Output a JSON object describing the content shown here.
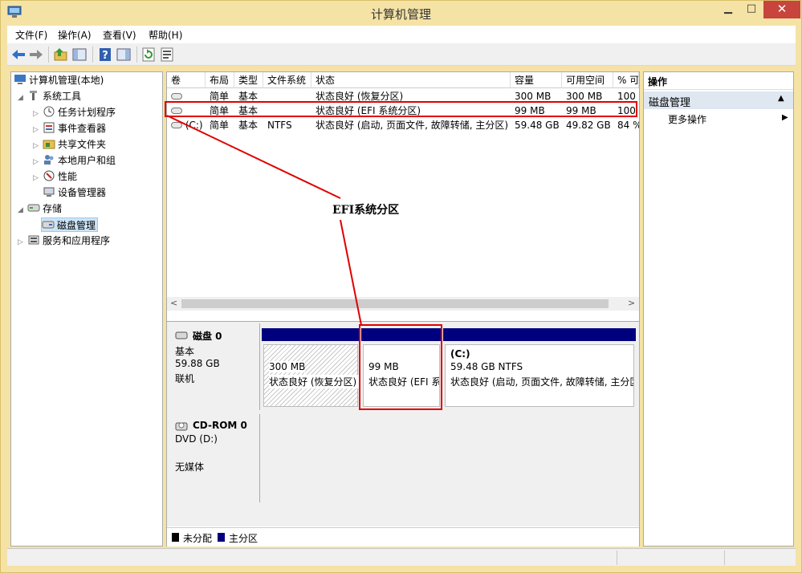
{
  "window": {
    "title": "计算机管理",
    "min_glyph": "▁",
    "max_glyph": "□",
    "close_glyph": "✕"
  },
  "menu": [
    {
      "label": "文件(F)"
    },
    {
      "label": "操作(A)"
    },
    {
      "label": "查看(V)"
    },
    {
      "label": "帮助(H)"
    }
  ],
  "toolbar_icons": [
    "back-arrow-icon",
    "forward-arrow-icon",
    "folder-up-icon",
    "show-hide-tree-icon",
    "help-icon",
    "show-hide-action-icon",
    "refresh-icon",
    "properties-icon"
  ],
  "tree": {
    "root": "计算机管理(本地)",
    "system_tools": "系统工具",
    "task_scheduler": "任务计划程序",
    "event_viewer": "事件查看器",
    "shared_folders": "共享文件夹",
    "local_users": "本地用户和组",
    "performance": "性能",
    "device_manager": "设备管理器",
    "storage": "存储",
    "disk_management": "磁盘管理",
    "services_apps": "服务和应用程序"
  },
  "volumes": {
    "headers": {
      "volume": "卷",
      "layout": "布局",
      "type": "类型",
      "fs": "文件系统",
      "status": "状态",
      "capacity": "容量",
      "free": "可用空间",
      "pct": "% 可"
    },
    "rows": [
      {
        "volume": "",
        "layout": "简单",
        "type": "基本",
        "fs": "",
        "status": "状态良好 (恢复分区)",
        "capacity": "300 MB",
        "free": "300 MB",
        "pct": "100"
      },
      {
        "volume": "",
        "layout": "简单",
        "type": "基本",
        "fs": "",
        "status": "状态良好 (EFI 系统分区)",
        "capacity": "99 MB",
        "free": "99 MB",
        "pct": "100"
      },
      {
        "volume": "(C:)",
        "layout": "简单",
        "type": "基本",
        "fs": "NTFS",
        "status": "状态良好 (启动, 页面文件, 故障转储, 主分区)",
        "capacity": "59.48 GB",
        "free": "49.82 GB",
        "pct": "84 %"
      }
    ]
  },
  "disk0": {
    "name": "磁盘 0",
    "type": "基本",
    "size": "59.88 GB",
    "state": "联机",
    "partitions": [
      {
        "name": "",
        "size": "300 MB",
        "status": "状态良好 (恢复分区)"
      },
      {
        "name": "",
        "size": "99 MB",
        "status": "状态良好 (EFI 系"
      },
      {
        "name": "(C:)",
        "size": "59.48 GB NTFS",
        "status": "状态良好 (启动, 页面文件, 故障转储, 主分区"
      }
    ]
  },
  "cdrom0": {
    "name": "CD-ROM 0",
    "drive": "DVD (D:)",
    "media": "无媒体"
  },
  "legend": {
    "unallocated": "未分配",
    "primary": "主分区"
  },
  "actions": {
    "header": "操作",
    "section": "磁盘管理",
    "more": "更多操作"
  },
  "annotation": {
    "label": "EFI系统分区"
  },
  "colors": {
    "highlight_red": "#e00000",
    "primary_partition": "#00007f",
    "unallocated": "#000000",
    "frame": "#f5e3a6"
  }
}
